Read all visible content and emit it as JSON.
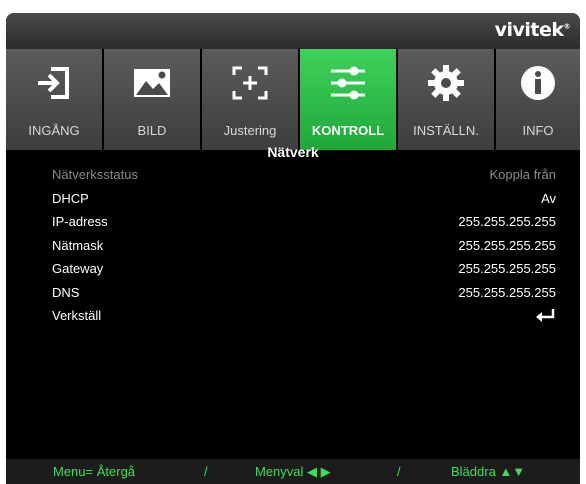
{
  "brand": {
    "logo": "vivitek"
  },
  "tabs": [
    {
      "label": "INGÅNG",
      "icon": "input-icon",
      "active": false
    },
    {
      "label": "BILD",
      "icon": "picture-icon",
      "active": false
    },
    {
      "label": "Justering",
      "icon": "adjust-icon",
      "active": false
    },
    {
      "label": "KONTROLL",
      "icon": "sliders-icon",
      "active": true
    },
    {
      "label": "INSTÄLLN.",
      "icon": "gear-icon",
      "active": false
    },
    {
      "label": "INFO",
      "icon": "info-icon",
      "active": false
    }
  ],
  "page": {
    "title": "Nätverk"
  },
  "settings": [
    {
      "label": "Nätverksstatus",
      "value": "Koppla från",
      "dim": true
    },
    {
      "label": "DHCP",
      "value": "Av"
    },
    {
      "label": "IP-adress",
      "value": "255.255.255.255"
    },
    {
      "label": "Nätmask",
      "value": "255.255.255.255"
    },
    {
      "label": "Gateway",
      "value": "255.255.255.255"
    },
    {
      "label": "DNS",
      "value": "255.255.255.255"
    },
    {
      "label": "Verkställ",
      "icon": "enter-icon"
    }
  ],
  "footer": {
    "menu": "Menu= Återgå",
    "sep1": "/",
    "select": "Menyval ◀ ▶",
    "sep2": "/",
    "browse": "Bläddra ▲▼"
  },
  "colors": {
    "active_tab": "#2bbf48",
    "footer_text": "#3ddc5a",
    "background": "#000000"
  }
}
